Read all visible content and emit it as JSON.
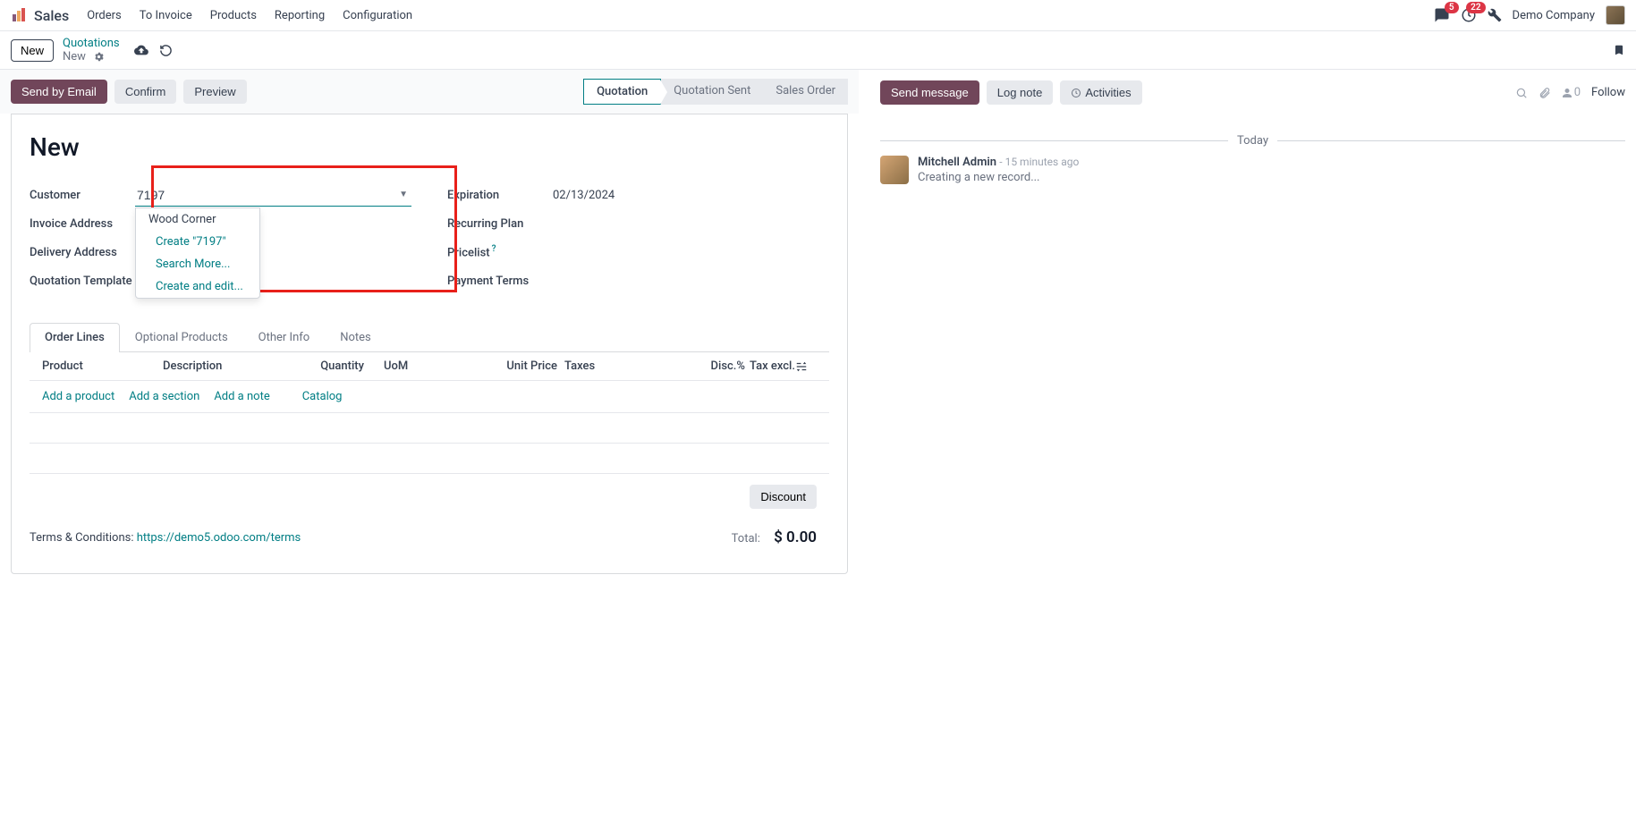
{
  "header": {
    "app_name": "Sales",
    "nav": [
      "Orders",
      "To Invoice",
      "Products",
      "Reporting",
      "Configuration"
    ],
    "msg_badge": "5",
    "act_badge": "22",
    "company": "Demo Company"
  },
  "breadcrumb": {
    "new_btn": "New",
    "parent": "Quotations",
    "current": "New"
  },
  "actions": {
    "send_email": "Send by Email",
    "confirm": "Confirm",
    "preview": "Preview",
    "status": [
      "Quotation",
      "Quotation Sent",
      "Sales Order"
    ]
  },
  "form": {
    "title": "New",
    "labels": {
      "customer": "Customer",
      "invoice_addr": "Invoice Address",
      "delivery_addr": "Delivery Address",
      "quot_template": "Quotation Template",
      "expiration": "Expiration",
      "recurring": "Recurring Plan",
      "pricelist": "Pricelist",
      "payment_terms": "Payment Terms"
    },
    "customer_value": "7197",
    "expiration_value": "02/13/2024",
    "dropdown": {
      "opt1": "Wood Corner",
      "create": "Create \"7197\"",
      "search": "Search More...",
      "create_edit": "Create and edit..."
    }
  },
  "tabs": [
    "Order Lines",
    "Optional Products",
    "Other Info",
    "Notes"
  ],
  "table": {
    "headers": {
      "product": "Product",
      "description": "Description",
      "quantity": "Quantity",
      "uom": "UoM",
      "unit_price": "Unit Price",
      "taxes": "Taxes",
      "disc": "Disc.%",
      "tax_excl": "Tax excl."
    },
    "actions": {
      "add_product": "Add a product",
      "add_section": "Add a section",
      "add_note": "Add a note",
      "catalog": "Catalog"
    },
    "discount_btn": "Discount",
    "terms_prefix": "Terms & Conditions: ",
    "terms_link": "https://demo5.odoo.com/terms",
    "total_label": "Total:",
    "total_value": "$ 0.00"
  },
  "chatter": {
    "send_msg": "Send message",
    "log_note": "Log note",
    "activities": "Activities",
    "follow": "Follow",
    "follow_count": "0",
    "divider": "Today",
    "entry": {
      "author": "Mitchell Admin",
      "time": "- 15 minutes ago",
      "msg": "Creating a new record..."
    }
  }
}
